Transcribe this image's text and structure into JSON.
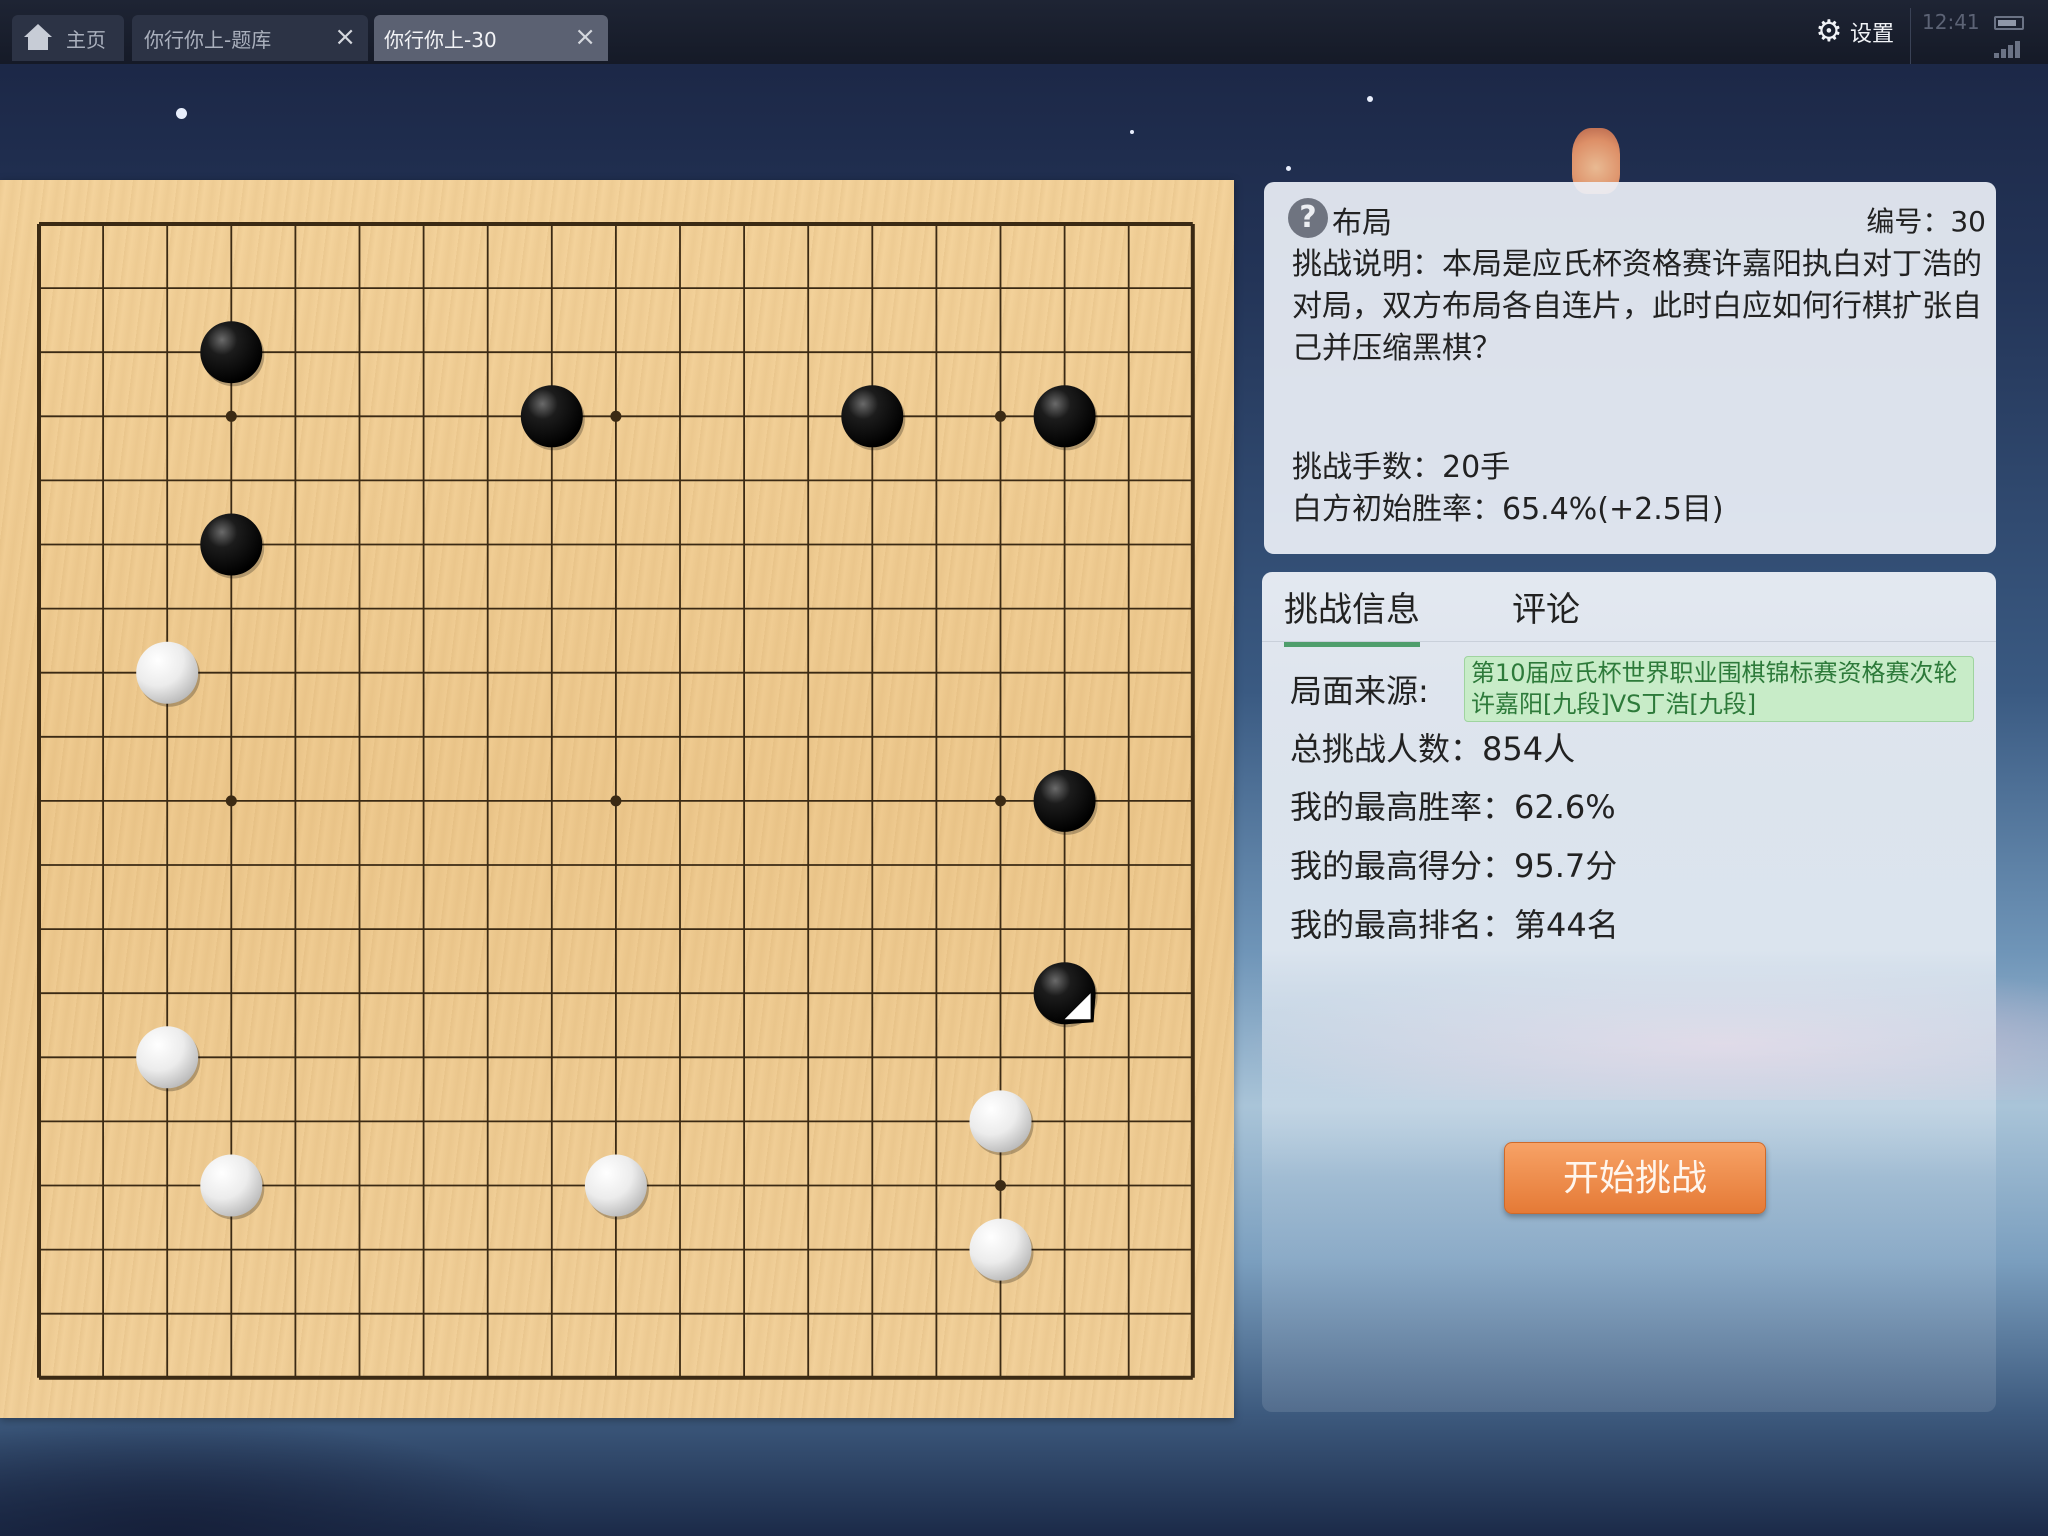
{
  "tabbar": {
    "home_label": "主页",
    "tabs": [
      {
        "label": "你行你上-题库",
        "close_icon": "close-icon"
      },
      {
        "label": "你行你上-30",
        "close_icon": "close-icon"
      }
    ],
    "settings_label": "设置",
    "clock": "12:41"
  },
  "problem": {
    "category": "布局",
    "number_label": "编号：30",
    "description": "挑战说明：本局是应氏杯资格赛许嘉阳执白对丁浩的对局，双方布局各自连片，此时白应如何行棋扩张自己并压缩黑棋？",
    "moves_label": "挑战手数：20手",
    "winrate_label": "白方初始胜率：65.4%(+2.5目)"
  },
  "info": {
    "tabs": [
      "挑战信息",
      "评论"
    ],
    "source_label": "局面来源:",
    "source_value": "第10届应氏杯世界职业围棋锦标赛资格赛次轮 许嘉阳[九段]VS丁浩[九段]",
    "total_label": "总挑战人数：854人",
    "best_winrate_label": "我的最高胜率：62.6%",
    "best_score_label": "我的最高得分：95.7分",
    "best_rank_label": "我的最高排名：第44名",
    "start_button": "开始挑战"
  },
  "board": {
    "size": 19,
    "visible_columns": 19,
    "visible_rows": 19,
    "star_points": [
      [
        3,
        3
      ],
      [
        9,
        3
      ],
      [
        15,
        3
      ],
      [
        3,
        9
      ],
      [
        9,
        9
      ],
      [
        15,
        9
      ],
      [
        3,
        15
      ],
      [
        9,
        15
      ],
      [
        15,
        15
      ]
    ],
    "stones": [
      {
        "color": "black",
        "col": 3,
        "row": 2
      },
      {
        "color": "black",
        "col": 8,
        "row": 3
      },
      {
        "color": "black",
        "col": 13,
        "row": 3
      },
      {
        "color": "black",
        "col": 16,
        "row": 3
      },
      {
        "color": "black",
        "col": 3,
        "row": 5
      },
      {
        "color": "white",
        "col": 2,
        "row": 7
      },
      {
        "color": "black",
        "col": 16,
        "row": 9
      },
      {
        "color": "black",
        "col": 16,
        "row": 12,
        "last_move": true
      },
      {
        "color": "white",
        "col": 2,
        "row": 13
      },
      {
        "color": "white",
        "col": 15,
        "row": 14
      },
      {
        "color": "white",
        "col": 3,
        "row": 15
      },
      {
        "color": "white",
        "col": 9,
        "row": 15
      },
      {
        "color": "white",
        "col": 15,
        "row": 16
      }
    ],
    "colors": {
      "board": "#f2d19b",
      "line": "#3b2a14"
    }
  },
  "colors": {
    "accent": "#e57a36",
    "tab_active": "#4f9e6c"
  }
}
